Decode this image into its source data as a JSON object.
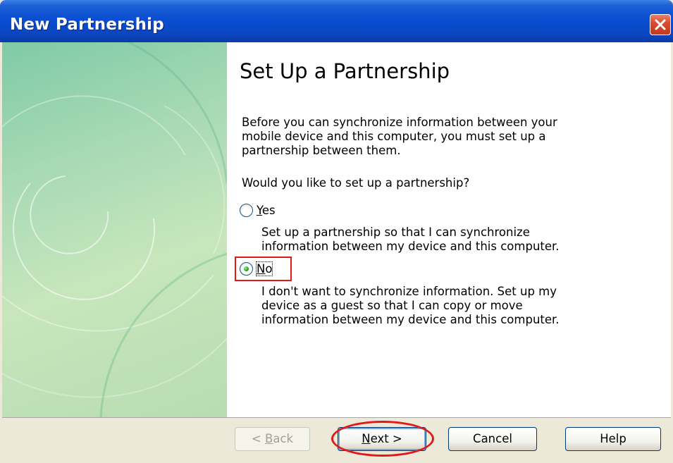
{
  "window": {
    "title": "New Partnership"
  },
  "content": {
    "heading": "Set Up a Partnership",
    "intro": "Before you can synchronize information between your mobile device and this computer, you must set up a partnership between them.",
    "question": "Would you like to set up a partnership?",
    "options": [
      {
        "label_prefix": "",
        "label_mnemonic": "Y",
        "label_rest": "es",
        "description": "Set up a partnership so that I can synchronize information between my device and this computer.",
        "selected": false
      },
      {
        "label_prefix": "",
        "label_mnemonic": "N",
        "label_rest": "o",
        "description": "I don't want to synchronize information. Set up my device as a guest so that I can copy or move information between my device and this computer.",
        "selected": true
      }
    ]
  },
  "buttons": {
    "back": {
      "pre": "< ",
      "mnemonic": "B",
      "rest": "ack",
      "enabled": false
    },
    "next": {
      "mnemonic": "N",
      "rest": "ext >",
      "enabled": true
    },
    "cancel": {
      "label": "Cancel",
      "enabled": true
    },
    "help": {
      "label": "Help",
      "enabled": true
    }
  },
  "colors": {
    "titlebar": "#0a4ed2",
    "highlight": "#e01a1a",
    "panel_green": "#a6d9b4"
  },
  "icons": {
    "close": "close-icon",
    "radio_selected": "radio-selected-icon",
    "radio_unselected": "radio-unselected-icon"
  }
}
